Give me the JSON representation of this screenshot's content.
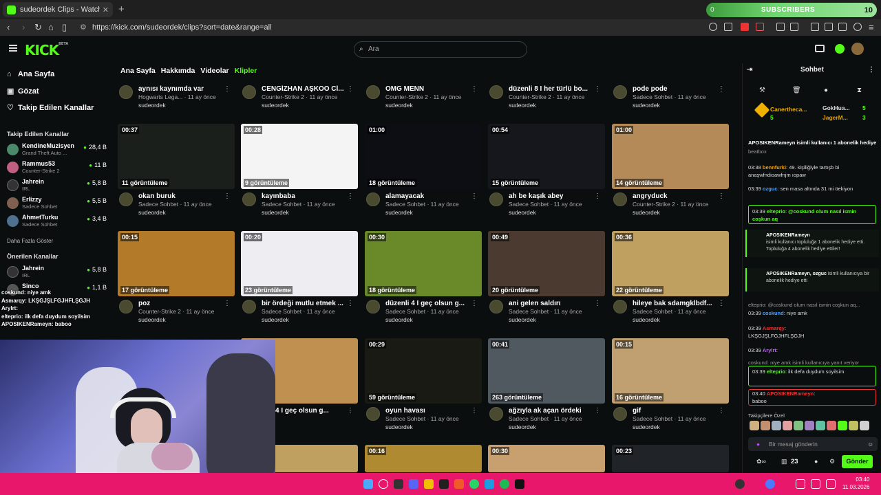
{
  "browser": {
    "tab_title": "sudeordek Clips - Watch Live on",
    "url": "https://kick.com/sudeordek/clips?sort=date&range=all"
  },
  "subs_widget": {
    "left": "0",
    "label": "SUBSCRIBERS",
    "right": "10"
  },
  "header": {
    "logo": "KICK",
    "logo_sup": "BETA",
    "search_placeholder": "Ara"
  },
  "sidebar": {
    "nav": [
      {
        "label": "Ana Sayfa",
        "icon": "home-icon"
      },
      {
        "label": "Gözat",
        "icon": "browse-icon"
      },
      {
        "label": "Takip Edilen Kanallar",
        "icon": "heart-icon"
      }
    ],
    "followed_title": "Takip Edilen Kanallar",
    "followed": [
      {
        "name": "KendineMuzisyen",
        "game": "Grand Theft Auto ...",
        "viewers": "28,4 B",
        "color": "#4a8a6a"
      },
      {
        "name": "Rammus53",
        "game": "Counter-Strike 2",
        "viewers": "11 B",
        "color": "#c06080"
      },
      {
        "name": "Jahrein",
        "game": "IRL",
        "viewers": "5,8 B",
        "color": "#333"
      },
      {
        "name": "Erlizzy",
        "game": "Sadece Sohbet",
        "viewers": "5,5 B",
        "color": "#806050"
      },
      {
        "name": "AhmetTurku",
        "game": "Sadece Sohbet",
        "viewers": "3,4 B",
        "color": "#507090"
      }
    ],
    "more_label": "Daha Fazla Göster",
    "suggested_title": "Önerilen Kanallar",
    "suggested": [
      {
        "name": "Jahrein",
        "game": "IRL",
        "viewers": "5,8 B",
        "color": "#333"
      },
      {
        "name": "Sinco",
        "game": "",
        "viewers": "1,1 B",
        "color": "#555"
      }
    ]
  },
  "tabs": [
    {
      "label": "Ana Sayfa",
      "active": false
    },
    {
      "label": "Hakkımda",
      "active": false
    },
    {
      "label": "Videolar",
      "active": false
    },
    {
      "label": "Klipler",
      "active": true
    }
  ],
  "clips_row0": [
    {
      "title": "aynısı kaynımda var",
      "cat": "Hogwarts Lega... · 11 ay önce",
      "channel": "sudeordek"
    },
    {
      "title": "CENGİZHAN AŞKOO Cİ...",
      "cat": "Counter-Strike 2 · 11 ay önce",
      "channel": "sudeordek"
    },
    {
      "title": "OMG MENN",
      "cat": "Counter-Strike 2 · 11 ay önce",
      "channel": "sudeordek"
    },
    {
      "title": "düzenli 8 I her türlü bo...",
      "cat": "Counter-Strike 2 · 11 ay önce",
      "channel": "sudeordek"
    },
    {
      "title": "pode pode",
      "cat": "Sadece Sohbet · 11 ay önce",
      "channel": "sudeordek"
    }
  ],
  "clips_row1": [
    {
      "duration": "00:37",
      "views": "11 görüntüleme",
      "title": "okan buruk",
      "cat": "Sadece Sohbet · 11 ay önce",
      "channel": "sudeordek",
      "bg": "#1a1f1c"
    },
    {
      "duration": "00:28",
      "views": "9 görüntüleme",
      "title": "kayınbaba",
      "cat": "Sadece Sohbet · 11 ay önce",
      "channel": "sudeordek",
      "bg": "#f4f4f4"
    },
    {
      "duration": "01:00",
      "views": "18 görüntüleme",
      "title": "alamayacak",
      "cat": "Sadece Sohbet · 11 ay önce",
      "channel": "sudeordek",
      "bg": "#0d0d14"
    },
    {
      "duration": "00:54",
      "views": "15 görüntüleme",
      "title": "ah be kaşık abey",
      "cat": "Sadece Sohbet · 11 ay önce",
      "channel": "sudeordek",
      "bg": "#15171c"
    },
    {
      "duration": "01:00",
      "views": "14 görüntüleme",
      "title": "angryduck",
      "cat": "Counter-Strike 2 · 11 ay önce",
      "channel": "sudeordek",
      "bg": "#b48a58"
    }
  ],
  "clips_row2": [
    {
      "duration": "00:15",
      "views": "17 görüntüleme",
      "title": "poz",
      "cat": "Counter-Strike 2 · 11 ay önce",
      "channel": "sudeordek",
      "bg": "#b37a2a"
    },
    {
      "duration": "00:20",
      "views": "23 görüntüleme",
      "title": "bir ördeği mutlu etmek ...",
      "cat": "Sadece Sohbet · 11 ay önce",
      "channel": "sudeordek",
      "bg": "#eeeef2"
    },
    {
      "duration": "00:30",
      "views": "18 görüntüleme",
      "title": "düzenli 4 I geç olsun g...",
      "cat": "Sadece Sohbet · 11 ay önce",
      "channel": "sudeordek",
      "bg": "#6a8a2a"
    },
    {
      "duration": "00:49",
      "views": "20 görüntüleme",
      "title": "ani gelen saldırı",
      "cat": "Sadece Sohbet · 11 ay önce",
      "channel": "sudeordek",
      "bg": "#4a3a30"
    },
    {
      "duration": "00:36",
      "views": "22 görüntüleme",
      "title": "hileye bak sdamgklbdf...",
      "cat": "Sadece Sohbet · 11 ay önce",
      "channel": "sudeordek",
      "bg": "#c0a060"
    }
  ],
  "clips_row3": [
    {
      "duration": "",
      "views": "üleme",
      "title": "enli 4 I geç olsun g...",
      "cat": "",
      "channel": "",
      "bg": "#c09050"
    },
    {
      "duration": "00:29",
      "views": "59 görüntüleme",
      "title": "oyun havası",
      "cat": "Sadece Sohbet · 11 ay önce",
      "channel": "sudeordek",
      "bg": "#1a1a14"
    },
    {
      "duration": "00:41",
      "views": "263 görüntüleme",
      "title": "ağzıyla ak açan ördeki",
      "cat": "Sadece Sohbet · 11 ay önce",
      "channel": "sudeordek",
      "bg": "#505860"
    },
    {
      "duration": "00:15",
      "views": "16 görüntüleme",
      "title": "gif",
      "cat": "Sadece Sohbet · 11 ay önce",
      "channel": "sudeordek",
      "bg": "#c0a070"
    }
  ],
  "clips_row4": [
    {
      "duration": "",
      "bg": "#c0a060"
    },
    {
      "duration": "00:16",
      "bg": "#b08a30"
    },
    {
      "duration": "00:30",
      "bg": "#c8a070"
    },
    {
      "duration": "00:23",
      "bg": "#202428"
    }
  ],
  "chat": {
    "title": "Sohbet",
    "gifters": [
      {
        "name": "Canerthecа...",
        "count": "5"
      },
      {
        "name": "GokHua...",
        "count": "5"
      },
      {
        "name": "JagerM...",
        "count": "3"
      }
    ],
    "pinned": "APOSIKENRameyn isimli kullanıcı 1 abonelik hediye",
    "messages": [
      {
        "text": "beatbox"
      },
      {
        "time": "03:38",
        "user": "bennfurki",
        "user_color": "#f0a000",
        "text": "49. kişiliğiyle tartışb bi anaşwfndioawfnjm ıopaw"
      },
      {
        "time": "03:39",
        "user": "ozguc",
        "user_color": "#4aa0ff",
        "text": "sen masa altında 31 mi öekiyon"
      },
      {
        "time": "03:39",
        "user": "eltеprio",
        "user_color": "#53fc18",
        "text": "@coskund olum nasıl ismin coşkun aq"
      }
    ],
    "sys1_title": "APOSIKENRameyn",
    "sys1_text": "isimli kullanıcı topluluğa 1 abonelik hediye etti. Topluluğa 4 abonelik hediye ettiler!",
    "sys2_title": "APOSIKENRameyn, ozguc",
    "sys2_text": "isimli kullanıcıya bir abonelik hediye etti",
    "reply1": "eltеprio: @coskund olum nasıl ismin coşkun aq...",
    "m5_time": "03:39",
    "m5_user": "coskund",
    "m5_text": "niye amk",
    "m6_time": "03:39",
    "m6_user": "Asmarqy",
    "m6_text": "LKŞGJŞLFGJHFLŞGJH",
    "m7_time": "03:39",
    "m7_user": "Arylrt",
    "reply2": "coskund: niye amk isimli kullanıcıya yanıt veriyor",
    "m8_time": "03:39",
    "m8_user": "eltеprio",
    "m8_text": "ilk defa duydum soyilsim",
    "m9_time": "03:40",
    "m9_user": "APOSIKENRameyn",
    "m9_text": "baboo",
    "emote_title": "Takipçilere Özel",
    "input_placeholder": "Bir mesaj gönderin",
    "points": "23",
    "send": "Gönder"
  },
  "overlay_chat": [
    "coskund: niye amk",
    "Asmarqy: LKŞGJŞLFGJHFLŞGJH",
    "Arylrt:",
    "eltеprio: ilk defa duydum soyilsim",
    "APOSIKENRameyn: baboo"
  ],
  "clock": {
    "time": "03:40",
    "date": "11.03.2026"
  }
}
